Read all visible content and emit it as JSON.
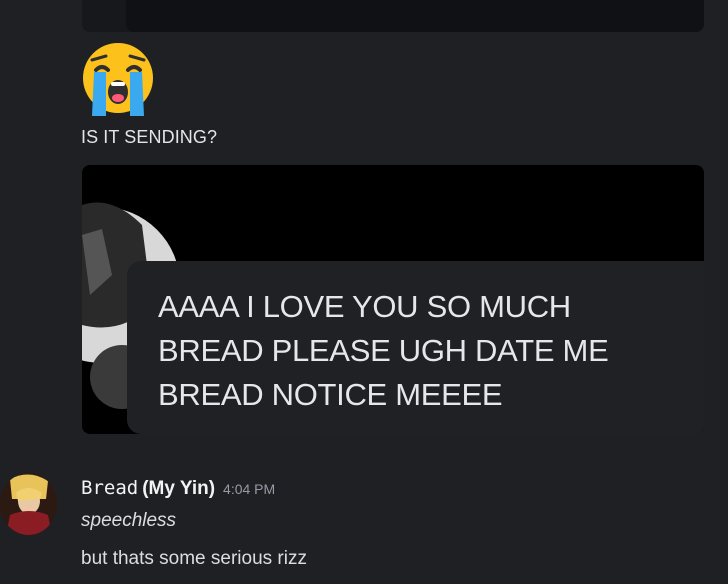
{
  "messages": [
    {
      "emoji": "loudly-crying-face",
      "text": "IS IT SENDING?",
      "attachment": {
        "lines": [
          "AAAA I LOVE YOU SO MUCH",
          "BREAD PLEASE UGH DATE ME",
          "BREAD NOTICE MEEEE"
        ]
      }
    },
    {
      "username": "Bread",
      "nickname": "(My Yin)",
      "timestamp": "4:04 PM",
      "lines": [
        "speechless",
        "but thats some serious rizz"
      ]
    }
  ],
  "colors": {
    "background": "#1f2023",
    "text": "#dbdee1",
    "timestamp": "#949ba4"
  }
}
